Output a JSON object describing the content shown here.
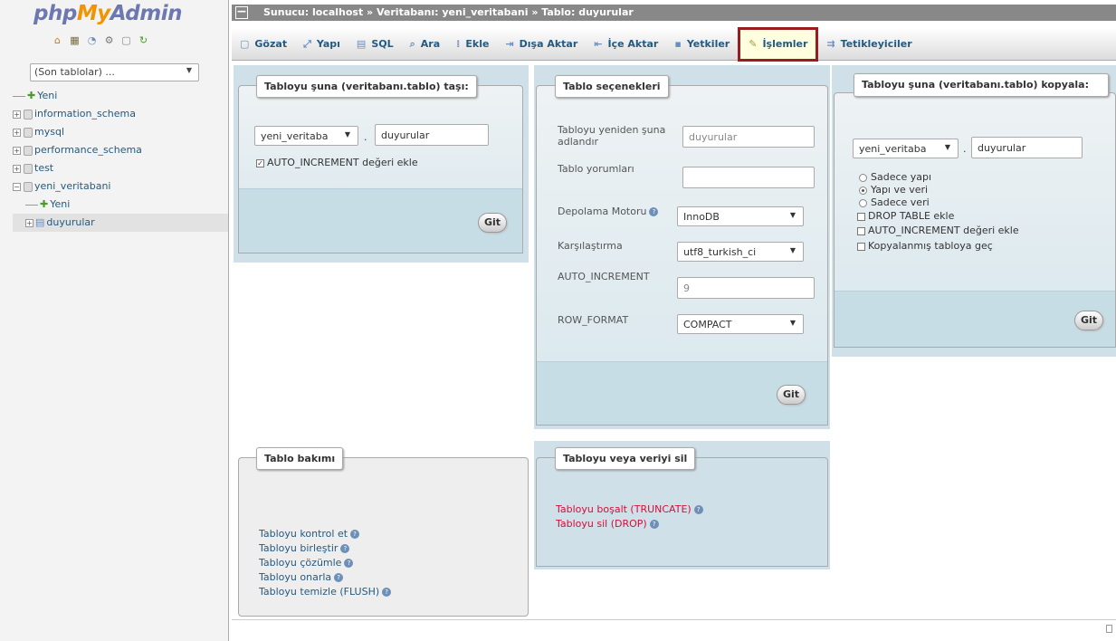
{
  "logo": {
    "php": "php",
    "my": "My",
    "admin": "Admin"
  },
  "nav_icons": [
    "home-icon",
    "db-icon",
    "query-icon",
    "settings-icon",
    "docs-icon",
    "reload-icon"
  ],
  "recent_tables": {
    "value": "(Son tablolar) ..."
  },
  "tree": [
    {
      "label": "Yeni",
      "type": "new"
    },
    {
      "label": "information_schema",
      "type": "db"
    },
    {
      "label": "mysql",
      "type": "db"
    },
    {
      "label": "performance_schema",
      "type": "db"
    },
    {
      "label": "test",
      "type": "db"
    },
    {
      "label": "yeni_veritabani",
      "type": "db"
    },
    {
      "label": "Yeni",
      "type": "new-child"
    },
    {
      "label": "duyurular",
      "type": "table"
    }
  ],
  "breadcrumb": {
    "text": "Sunucu: localhost » Veritabanı: yeni_veritabani » Tablo: duyurular"
  },
  "tabs": [
    {
      "label": "Gözat",
      "icon": "browse-icon"
    },
    {
      "label": "Yapı",
      "icon": "structure-icon"
    },
    {
      "label": "SQL",
      "icon": "sql-icon"
    },
    {
      "label": "Ara",
      "icon": "search-icon"
    },
    {
      "label": "Ekle",
      "icon": "insert-icon"
    },
    {
      "label": "Dışa Aktar",
      "icon": "export-icon"
    },
    {
      "label": "İçe Aktar",
      "icon": "import-icon"
    },
    {
      "label": "Yetkiler",
      "icon": "privileges-icon"
    },
    {
      "label": "İşlemler",
      "icon": "operations-icon"
    },
    {
      "label": "Tetikleyiciler",
      "icon": "triggers-icon"
    }
  ],
  "move": {
    "legend": "Tabloyu şuna (veritabanı.tablo) taşı:",
    "db_select": "yeni_veritaba",
    "table_value": "duyurular",
    "autoinc_label": "AUTO_INCREMENT değeri ekle",
    "go": "Git"
  },
  "options": {
    "legend": "Tablo seçenekleri",
    "rename_label": "Tabloyu yeniden şuna adlandır",
    "rename_value": "duyurular",
    "comment_label": "Tablo yorumları",
    "comment_value": "",
    "engine_label": "Depolama Motoru",
    "engine_value": "InnoDB",
    "collation_label": "Karşılaştırma",
    "collation_value": "utf8_turkish_ci",
    "autoinc_label": "AUTO_INCREMENT",
    "autoinc_value": "9",
    "rowformat_label": "ROW_FORMAT",
    "rowformat_value": "COMPACT",
    "go": "Git"
  },
  "copy": {
    "legend": "Tabloyu şuna (veritabanı.tablo) kopyala:",
    "db_select": "yeni_veritaba",
    "table_value": "duyurular",
    "opt_structure": "Sadece yapı",
    "opt_structure_data": "Yapı ve veri",
    "opt_data": "Sadece veri",
    "drop_label": "DROP TABLE ekle",
    "autoinc_label": "AUTO_INCREMENT değeri ekle",
    "switch_label": "Kopyalanmış tabloya geç",
    "go": "Git"
  },
  "maintenance": {
    "legend": "Tablo bakımı",
    "links": [
      "Tabloyu kontrol et",
      "Tabloyu birleştir",
      "Tabloyu çözümle",
      "Tabloyu onarla",
      "Tabloyu temizle (FLUSH)"
    ]
  },
  "delete": {
    "legend": "Tabloyu veya veriyi sil",
    "truncate": "Tabloyu boşalt (TRUNCATE)",
    "drop": "Tabloyu sil (DROP)"
  },
  "colors": {
    "accent": "#235a81",
    "danger": "#d0103a",
    "highlight_border": "#9b1c1c"
  }
}
